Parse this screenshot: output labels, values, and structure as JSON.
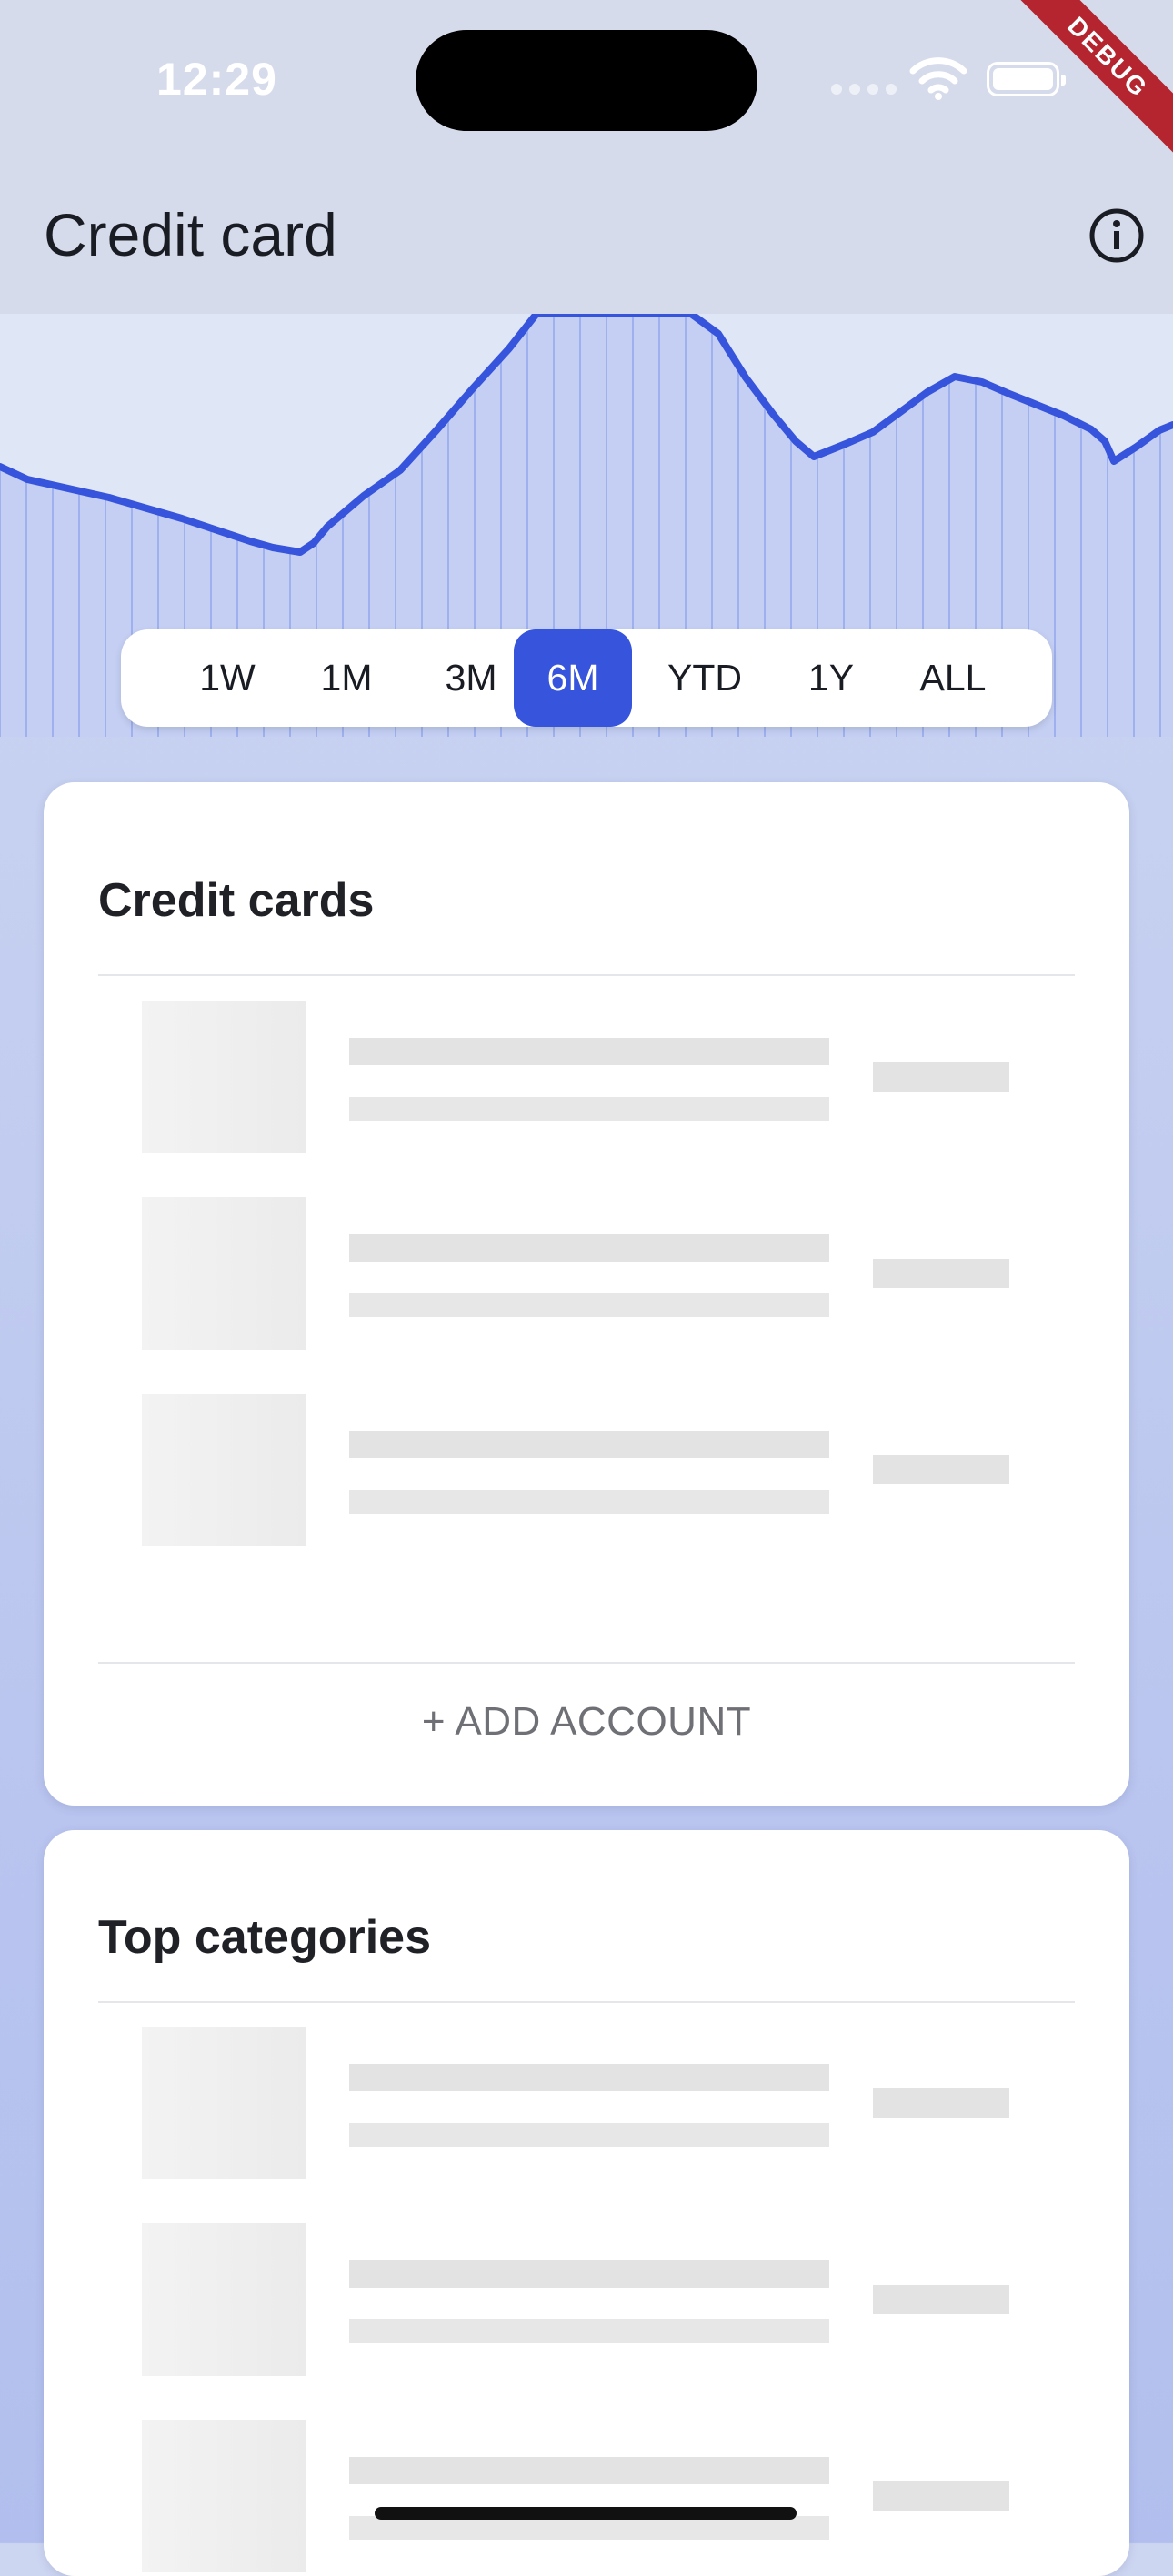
{
  "status_bar": {
    "time": "12:29"
  },
  "app_bar": {
    "title": "Credit card",
    "info_icon": "info-circle-icon"
  },
  "range_selector": {
    "options": [
      "1W",
      "1M",
      "3M",
      "6M",
      "YTD",
      "1Y",
      "ALL"
    ],
    "selected": "6M"
  },
  "cards": [
    {
      "title": "Credit cards",
      "action_label": "+ ADD ACCOUNT"
    },
    {
      "title": "Top categories"
    }
  ],
  "debug_banner": "DEBUG",
  "colors": {
    "accent": "#3654dc",
    "chart_fill": "#c4cff3",
    "debug": "#b4252f"
  }
}
